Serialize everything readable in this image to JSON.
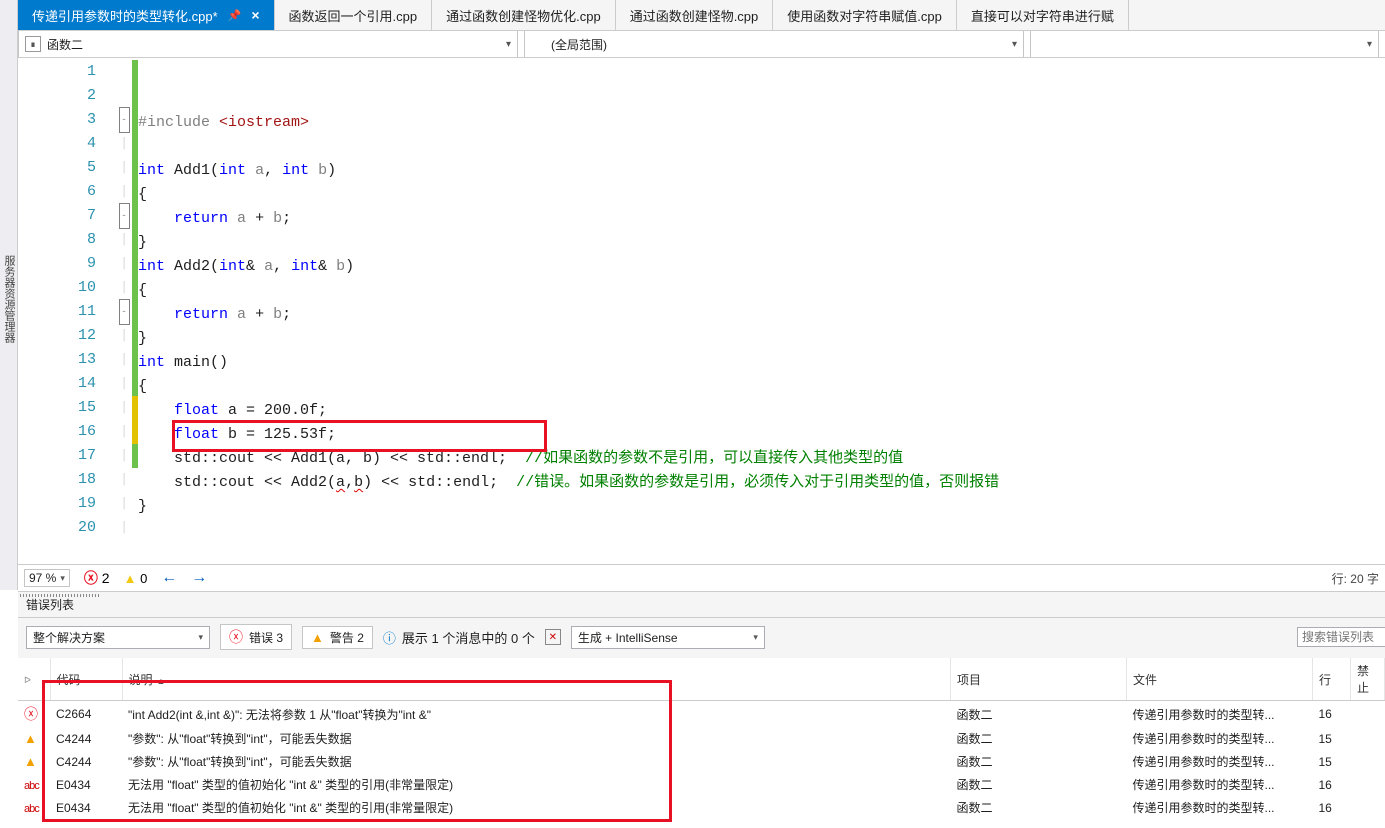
{
  "side_label": "服务器资源管理器",
  "tabs": [
    {
      "label": "传递引用参数时的类型转化.cpp*",
      "active": true,
      "dirty": true,
      "pinned": true
    },
    {
      "label": "函数返回一个引用.cpp"
    },
    {
      "label": "通过函数创建怪物优化.cpp"
    },
    {
      "label": "通过函数创建怪物.cpp"
    },
    {
      "label": "使用函数对字符串赋值.cpp"
    },
    {
      "label": "直接可以对字符串进行赋"
    }
  ],
  "nav": {
    "scope1": "函数二",
    "scope2": "(全局范围)",
    "scope3": ""
  },
  "code": {
    "lines": [
      {
        "n": 1,
        "chg": "green",
        "fold": "",
        "html": "<span class='k-gray'>#include</span> <span class='k-red'>&lt;iostream&gt;</span>"
      },
      {
        "n": 2,
        "chg": "green",
        "fold": "",
        "html": ""
      },
      {
        "n": 3,
        "chg": "green",
        "fold": "box",
        "html": "<span class='k-blue'>int</span> Add1(<span class='k-blue'>int</span> <span class='k-gray'>a</span>, <span class='k-blue'>int</span> <span class='k-gray'>b</span>)"
      },
      {
        "n": 4,
        "chg": "green",
        "fold": "",
        "html": "{"
      },
      {
        "n": 5,
        "chg": "green",
        "fold": "",
        "html": "    <span class='k-blue'>return</span> <span class='k-gray'>a</span> + <span class='k-gray'>b</span>;"
      },
      {
        "n": 6,
        "chg": "green",
        "fold": "",
        "html": "}"
      },
      {
        "n": 7,
        "chg": "green",
        "fold": "box",
        "html": "<span class='k-blue'>int</span> Add2(<span class='k-blue'>int</span>&amp; <span class='k-gray'>a</span>, <span class='k-blue'>int</span>&amp; <span class='k-gray'>b</span>)"
      },
      {
        "n": 8,
        "chg": "green",
        "fold": "",
        "html": "{"
      },
      {
        "n": 9,
        "chg": "green",
        "fold": "",
        "html": "    <span class='k-blue'>return</span> <span class='k-gray'>a</span> + <span class='k-gray'>b</span>;"
      },
      {
        "n": 10,
        "chg": "green",
        "fold": "",
        "html": "}"
      },
      {
        "n": 11,
        "chg": "green",
        "fold": "box",
        "html": "<span class='k-blue'>int</span> main()"
      },
      {
        "n": 12,
        "chg": "green",
        "fold": "",
        "html": "{"
      },
      {
        "n": 13,
        "chg": "green",
        "fold": "",
        "html": "    <span class='k-blue'>float</span> a = 200.0f;"
      },
      {
        "n": 14,
        "chg": "green",
        "fold": "",
        "html": "    <span class='k-blue'>float</span> b = 125.53f;"
      },
      {
        "n": 15,
        "chg": "yellow",
        "fold": "",
        "html": "    std::cout &lt;&lt; Add1(a, b) &lt;&lt; std::endl;  <span class='k-green'>//如果函数的参数不是引用，可以直接传入其他类型的值</span>"
      },
      {
        "n": 16,
        "chg": "yellow",
        "fold": "",
        "html": "    std::cout &lt;&lt; Add2(<span class='squig'>a</span>,<span class='squig'>b</span>) &lt;&lt; std::endl;  <span class='k-green'>//错误。如果函数的参数是引用，必须传入对于引用类型的值，否则报错</span>"
      },
      {
        "n": 17,
        "chg": "green",
        "fold": "",
        "html": "}"
      },
      {
        "n": 18,
        "chg": "",
        "fold": "",
        "html": ""
      },
      {
        "n": 19,
        "chg": "",
        "fold": "",
        "html": ""
      },
      {
        "n": 20,
        "chg": "",
        "fold": "",
        "html": ""
      }
    ]
  },
  "status": {
    "zoom": "97 %",
    "err_count": "2",
    "warn_count": "0",
    "pos": "行: 20    字"
  },
  "err_panel": {
    "title": "错误列表",
    "scope_label": "整个解决方案",
    "btn_err": "错误 3",
    "btn_warn": "警告 2",
    "btn_msg": "展示 1 个消息中的 0 个",
    "source_label": "生成 + IntelliSense",
    "search_placeholder": "搜索错误列表",
    "headers": {
      "code": "代码",
      "desc": "说明",
      "proj": "项目",
      "file": "文件",
      "line": "行",
      "sup": "禁止"
    },
    "rows": [
      {
        "ic": "e",
        "code": "C2664",
        "desc": "\"int Add2(int &,int &)\": 无法将参数 1 从\"float\"转换为\"int &\"",
        "proj": "函数二",
        "file": "传递引用参数时的类型转...",
        "line": "16"
      },
      {
        "ic": "w",
        "code": "C4244",
        "desc": "\"参数\": 从\"float\"转换到\"int\"，可能丢失数据",
        "proj": "函数二",
        "file": "传递引用参数时的类型转...",
        "line": "15"
      },
      {
        "ic": "w",
        "code": "C4244",
        "desc": "\"参数\": 从\"float\"转换到\"int\"，可能丢失数据",
        "proj": "函数二",
        "file": "传递引用参数时的类型转...",
        "line": "15"
      },
      {
        "ic": "a",
        "code": "E0434",
        "desc": "无法用 \"float\" 类型的值初始化 \"int &\" 类型的引用(非常量限定)",
        "proj": "函数二",
        "file": "传递引用参数时的类型转...",
        "line": "16"
      },
      {
        "ic": "a",
        "code": "E0434",
        "desc": "无法用 \"float\" 类型的值初始化 \"int &\" 类型的引用(非常量限定)",
        "proj": "函数二",
        "file": "传递引用参数时的类型转...",
        "line": "16"
      }
    ]
  }
}
